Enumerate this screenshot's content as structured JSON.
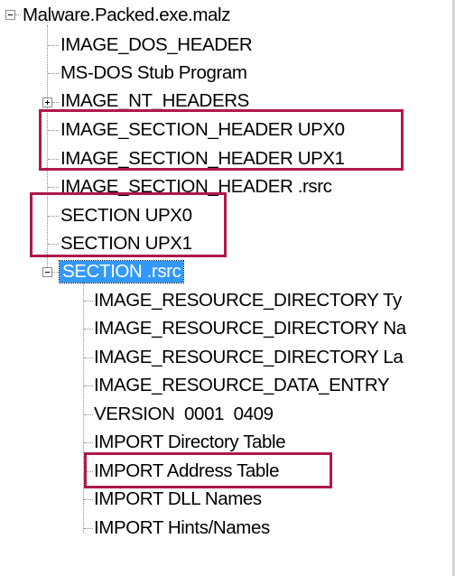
{
  "tree": {
    "root": {
      "label": "Malware.Packed.exe.malz",
      "expanded": true
    },
    "children": [
      {
        "label": "IMAGE_DOS_HEADER"
      },
      {
        "label": "MS-DOS Stub Program"
      },
      {
        "label": "IMAGE_NT_HEADERS",
        "expandable": true,
        "expanded": false
      },
      {
        "label": "IMAGE_SECTION_HEADER UPX0"
      },
      {
        "label": "IMAGE_SECTION_HEADER UPX1"
      },
      {
        "label": "IMAGE_SECTION_HEADER .rsrc"
      },
      {
        "label": "SECTION UPX0"
      },
      {
        "label": "SECTION UPX1"
      },
      {
        "label": "SECTION .rsrc",
        "expanded": true,
        "selected": true
      }
    ],
    "rsrc_children": [
      {
        "label": "IMAGE_RESOURCE_DIRECTORY Ty"
      },
      {
        "label": "IMAGE_RESOURCE_DIRECTORY Na"
      },
      {
        "label": "IMAGE_RESOURCE_DIRECTORY La"
      },
      {
        "label": "IMAGE_RESOURCE_DATA_ENTRY"
      },
      {
        "label": "VERSION  0001  0409"
      },
      {
        "label": "IMPORT Directory Table"
      },
      {
        "label": "IMPORT Address Table"
      },
      {
        "label": "IMPORT DLL Names"
      },
      {
        "label": "IMPORT Hints/Names"
      }
    ]
  },
  "colors": {
    "highlight_box": "#b0174a",
    "selection": "#3399ff"
  }
}
